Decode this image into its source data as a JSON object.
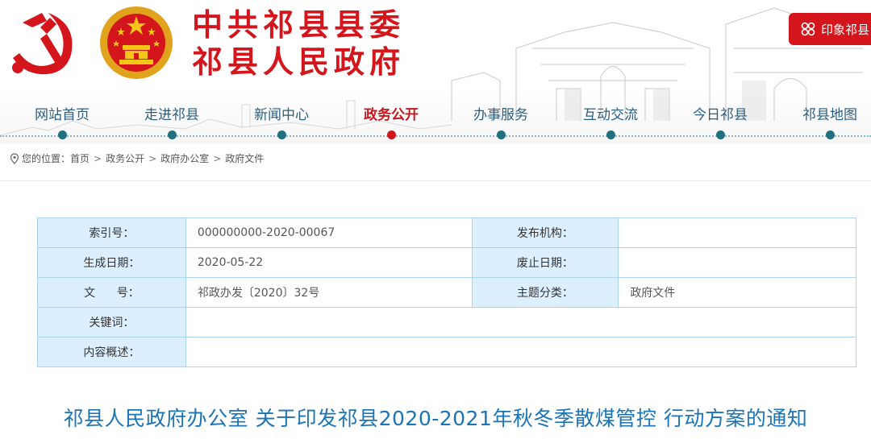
{
  "header": {
    "title_line1": "中共祁县县委",
    "title_line2": "祁县人民政府",
    "yinxiang_label": "印象祁县",
    "colors": {
      "brand_red": "#d4161c",
      "nav_blue": "#2a5e82",
      "title_blue": "#1a74b8"
    }
  },
  "nav": {
    "items": [
      {
        "label": "网站首页",
        "active": false
      },
      {
        "label": "走进祁县",
        "active": false
      },
      {
        "label": "新闻中心",
        "active": false
      },
      {
        "label": "政务公开",
        "active": true
      },
      {
        "label": "办事服务",
        "active": false
      },
      {
        "label": "互动交流",
        "active": false
      },
      {
        "label": "今日祁县",
        "active": false
      },
      {
        "label": "祁县地图",
        "active": false
      }
    ]
  },
  "breadcrumb": {
    "prefix": "您的位置：",
    "items": [
      "首页",
      "政务公开",
      "政府办公室",
      "政府文件"
    ]
  },
  "info_table": {
    "index_label": "索引号：",
    "index_value": "000000000-2020-00067",
    "publisher_label": "发布机构：",
    "publisher_value": "",
    "created_label": "生成日期：",
    "created_value": "2020-05-22",
    "abolished_label": "废止日期：",
    "abolished_value": "",
    "docno_label": "文      号：",
    "docno_value": "祁政办发〔2020〕32号",
    "category_label": "主题分类：",
    "category_value": "政府文件",
    "keywords_label": "关键词：",
    "keywords_value": "",
    "summary_label": "内容概述：",
    "summary_value": ""
  },
  "document": {
    "title": "祁县人民政府办公室 关于印发祁县2020-2021年秋冬季散煤管控 行动方案的通知"
  }
}
